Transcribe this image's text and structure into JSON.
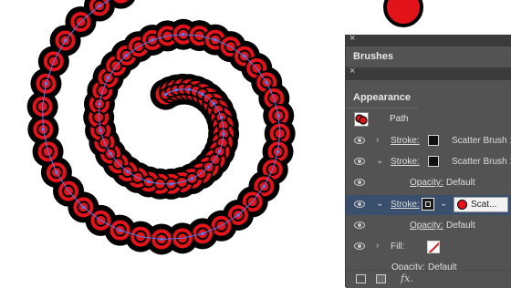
{
  "panels": {
    "brushes_tab": "Brushes",
    "appearance_tab": "Appearance",
    "close_glyph": "×"
  },
  "appearance": {
    "object_label": "Path",
    "rows": [
      {
        "label": "Stroke:",
        "brush": "Scatter Brush 1"
      },
      {
        "label": "Stroke:",
        "brush": "Scatter Brush 1"
      },
      {
        "label": "Opacity:",
        "value": "Default"
      },
      {
        "label": "Stroke:",
        "brush": "Scat..."
      },
      {
        "label": "Opacity:",
        "value": "Default"
      },
      {
        "label": "Fill:"
      },
      {
        "label": "Opacity:",
        "value": "Default"
      }
    ],
    "fx_label": "fx."
  },
  "colors": {
    "brush_red": "#e3131a",
    "brush_black": "#000000",
    "path_blue": "#4f7df0",
    "panel_bg": "#535353",
    "selected_row": "#3a4f6e"
  },
  "icons": [
    "eye-icon",
    "chevron-right-icon",
    "chevron-down-icon",
    "close-icon",
    "new-layer-icon",
    "duplicate-icon",
    "fx-icon"
  ]
}
